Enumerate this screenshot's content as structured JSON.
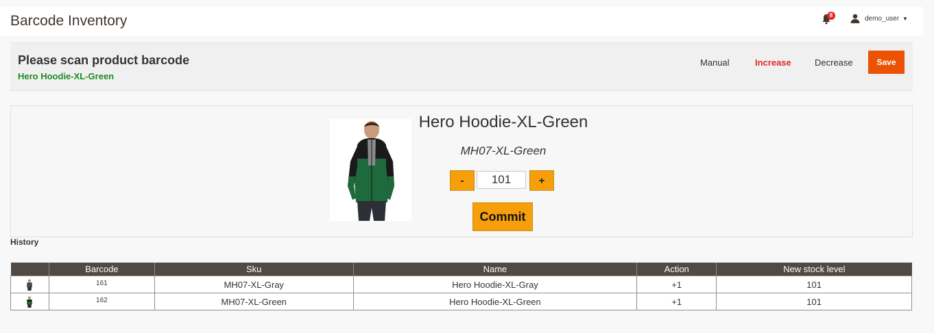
{
  "header": {
    "title": "Barcode Inventory",
    "notification_count": "8",
    "user_name": "demo_user"
  },
  "scan": {
    "prompt": "Please scan product barcode",
    "last_product": "Hero Hoodie-XL-Green",
    "modes": {
      "manual": "Manual",
      "increase": "Increase",
      "decrease": "Decrease"
    },
    "active_mode": "increase",
    "save_label": "Save"
  },
  "product": {
    "name": "Hero Hoodie-XL-Green",
    "sku": "MH07-XL-Green",
    "quantity": "101",
    "minus_label": "-",
    "plus_label": "+",
    "commit_label": "Commit"
  },
  "history": {
    "label": "History",
    "columns": [
      "",
      "Barcode",
      "Sku",
      "Name",
      "Action",
      "New stock level"
    ],
    "rows": [
      {
        "thumb": "hoodie-gray",
        "barcode": "161",
        "sku": "MH07-XL-Gray",
        "name": "Hero Hoodie-XL-Gray",
        "action": "+1",
        "new_stock": "101"
      },
      {
        "thumb": "hoodie-green",
        "barcode": "162",
        "sku": "MH07-XL-Green",
        "name": "Hero Hoodie-XL-Green",
        "action": "+1",
        "new_stock": "101"
      }
    ]
  },
  "colors": {
    "accent_orange": "#eb5202",
    "qty_button": "#f79e0b",
    "increase_active": "#e02b27",
    "product_green": "#1f8a24",
    "table_header": "#514943"
  },
  "icons": {
    "notifications": "bell-icon",
    "user": "user-icon",
    "dropdown": "caret-down-icon"
  }
}
